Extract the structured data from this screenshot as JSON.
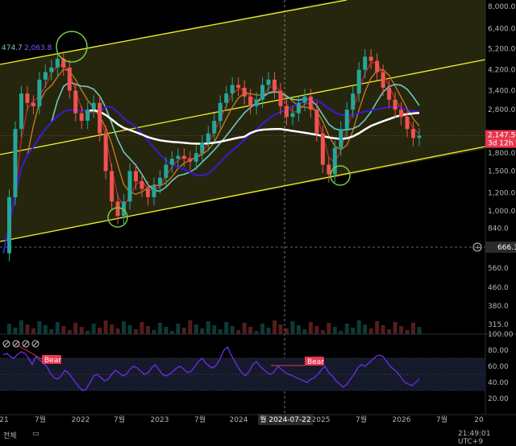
{
  "colors": {
    "background": "#000000",
    "channel_fill": "#2a2a10",
    "channel_line": "#f4f42a",
    "ma_red": "#c1272d",
    "ma_orange": "#c8801e",
    "ma_teal": "#6fc7c0",
    "ma_blue": "#3b18d6",
    "ma_white": "#ffffff",
    "candle_up": "#26a69a",
    "candle_down": "#ef5350",
    "rsi_line": "#6a2be0",
    "rsi_band": "#141a2a",
    "circle": "#7ac943",
    "price_tag": "#e8384f",
    "level_tag": "#2a2a2a"
  },
  "legend": {
    "value_a": "474.7",
    "value_b": "2,063.8"
  },
  "price_axis": {
    "ticks": [
      "8,000.0",
      "6,400.0",
      "5,200.0",
      "4,200.0",
      "3,400.0",
      "2,800.0",
      "2,200.0",
      "1,800.0",
      "1,500.0",
      "1,200.0",
      "1,000.0",
      "840.0",
      "700.0",
      "560.0",
      "460.0",
      "380.0",
      "315.0"
    ]
  },
  "current_price": {
    "value": "2,147.5",
    "countdown": "3d 12h"
  },
  "level_line": {
    "value": "666.3"
  },
  "rsi": {
    "ticks": [
      "100.00",
      "80.00",
      "60.00",
      "40.00",
      "20.00"
    ],
    "labels": [
      "Bear",
      "Bear"
    ],
    "values": [
      74,
      76,
      72,
      70,
      75,
      78,
      76,
      70,
      62,
      72,
      68,
      64,
      60,
      52,
      46,
      44,
      48,
      55,
      52,
      46,
      40,
      34,
      30,
      32,
      40,
      48,
      50,
      46,
      42,
      44,
      50,
      55,
      52,
      48,
      50,
      56,
      60,
      58,
      54,
      50,
      52,
      58,
      62,
      56,
      50,
      48,
      50,
      54,
      58,
      60,
      56,
      52,
      54,
      60,
      66,
      70,
      64,
      60,
      58,
      62,
      70,
      80,
      84,
      74,
      66,
      58,
      52,
      48,
      54,
      62,
      66,
      60,
      56,
      52,
      50,
      54,
      60,
      56,
      52,
      50,
      48,
      46,
      44,
      42,
      40,
      44,
      46,
      50,
      56,
      60,
      52,
      48,
      42,
      38,
      34,
      38,
      44,
      50,
      58,
      62,
      60,
      64,
      68,
      72,
      74,
      72,
      66,
      60,
      56,
      52,
      46,
      40,
      38,
      36,
      40,
      44
    ],
    "divergences": [
      "-",
      "-"
    ]
  },
  "time_axis": {
    "labels": [
      "21",
      "7월",
      "2022",
      "7월",
      "2023",
      "7월",
      "2024",
      "7월",
      "2025",
      "7월",
      "2026",
      "7월",
      "20"
    ],
    "crosshair_date": "월 2024-07-22"
  },
  "bottom_bar": {
    "left": "전체",
    "right": "21:49:01 UTC+9"
  },
  "icons": [
    "eye-off-icon",
    "plus-circle-icon"
  ],
  "chart_data": {
    "type": "candlestick",
    "y_scale": "log",
    "ylim": [
      300,
      8000
    ],
    "x_range": [
      "2021-01",
      "2026-12"
    ],
    "series": [
      {
        "name": "",
        "values": [
          650,
          1150,
          2300,
          3300,
          3000,
          2900,
          3800,
          4100,
          4300,
          4700,
          4300,
          3400,
          2700,
          2500,
          2800,
          3000,
          2200,
          1500,
          1100,
          950,
          1100,
          1500,
          1350,
          1250,
          1150,
          1300,
          1400,
          1600,
          1700,
          1750,
          1700,
          1650,
          1800,
          2000,
          2200,
          2500,
          3000,
          3300,
          3600,
          3500,
          3200,
          2900,
          3100,
          3600,
          3800,
          3400,
          2900,
          2600,
          2700,
          3000,
          3200,
          2800,
          2200,
          1600,
          1450,
          1900,
          2300,
          2800,
          3300,
          4200,
          4800,
          4600,
          4100,
          3500,
          3100,
          2800,
          2600,
          2300,
          2100,
          2147
        ]
      }
    ]
  }
}
